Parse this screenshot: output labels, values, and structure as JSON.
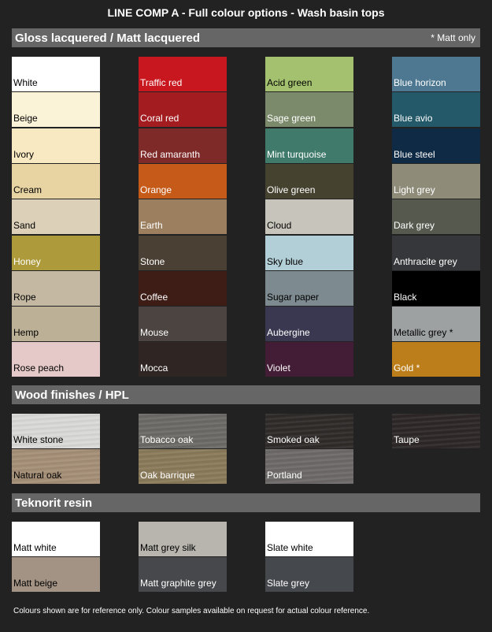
{
  "title": "LINE COMP A - Full colour options - Wash basin tops",
  "sections": [
    {
      "title": "Gloss lacquered / Matt lacquered",
      "note": "* Matt only",
      "columns": [
        [
          {
            "label": "White",
            "color": "#ffffff",
            "text": "#000000"
          },
          {
            "label": "Beige",
            "color": "#fbf3d7",
            "text": "#000000"
          },
          {
            "label": "Ivory",
            "color": "#f8e9c2",
            "text": "#000000"
          },
          {
            "label": "Cream",
            "color": "#e8d3a2",
            "text": "#000000"
          },
          {
            "label": "Sand",
            "color": "#dcd0b8",
            "text": "#000000"
          },
          {
            "label": "Honey",
            "color": "#ad9a3a",
            "text": "#ffffff"
          },
          {
            "label": "Rope",
            "color": "#c4b8a3",
            "text": "#000000"
          },
          {
            "label": "Hemp",
            "color": "#bcb096",
            "text": "#000000"
          },
          {
            "label": "Rose peach",
            "color": "#e5c8c8",
            "text": "#000000"
          }
        ],
        [
          {
            "label": "Traffic red",
            "color": "#c8171f",
            "text": "#ffffff"
          },
          {
            "label": "Coral red",
            "color": "#a21c20",
            "text": "#ffffff"
          },
          {
            "label": "Red amaranth",
            "color": "#7e2a28",
            "text": "#ffffff"
          },
          {
            "label": "Orange",
            "color": "#c55a19",
            "text": "#ffffff"
          },
          {
            "label": "Earth",
            "color": "#9b7f5e",
            "text": "#ffffff"
          },
          {
            "label": "Stone",
            "color": "#4a4034",
            "text": "#ffffff"
          },
          {
            "label": "Coffee",
            "color": "#3e1d17",
            "text": "#ffffff"
          },
          {
            "label": "Mouse",
            "color": "#4b4441",
            "text": "#ffffff"
          },
          {
            "label": "Mocca",
            "color": "#2f2624",
            "text": "#ffffff"
          }
        ],
        [
          {
            "label": "Acid green",
            "color": "#a4c16f",
            "text": "#000000"
          },
          {
            "label": "Sage green",
            "color": "#7b8a6a",
            "text": "#ffffff"
          },
          {
            "label": "Mint turquoise",
            "color": "#3f7a6b",
            "text": "#ffffff"
          },
          {
            "label": "Olive green",
            "color": "#45422f",
            "text": "#ffffff"
          },
          {
            "label": "Cloud",
            "color": "#c7c5bb",
            "text": "#000000"
          },
          {
            "label": "Sky blue",
            "color": "#b2ced6",
            "text": "#000000"
          },
          {
            "label": "Sugar paper",
            "color": "#7d8a90",
            "text": "#000000"
          },
          {
            "label": "Aubergine",
            "color": "#3a3750",
            "text": "#ffffff"
          },
          {
            "label": "Violet",
            "color": "#431c35",
            "text": "#ffffff"
          }
        ],
        [
          {
            "label": "Blue horizon",
            "color": "#4e7891",
            "text": "#ffffff"
          },
          {
            "label": "Blue avio",
            "color": "#24596a",
            "text": "#ffffff"
          },
          {
            "label": "Blue steel",
            "color": "#0e2a44",
            "text": "#ffffff"
          },
          {
            "label": "Light grey",
            "color": "#8e8b78",
            "text": "#ffffff"
          },
          {
            "label": "Dark grey",
            "color": "#565a4e",
            "text": "#ffffff"
          },
          {
            "label": "Anthracite grey",
            "color": "#35373a",
            "text": "#ffffff"
          },
          {
            "label": "Black",
            "color": "#000000",
            "text": "#ffffff"
          },
          {
            "label": "Metallic grey *",
            "color": "#9ea1a2",
            "text": "#000000"
          },
          {
            "label": "Gold *",
            "color": "#bb7e1b",
            "text": "#ffffff"
          }
        ]
      ]
    },
    {
      "title": "Wood finishes / HPL",
      "note": "",
      "columns": [
        [
          {
            "label": "White stone",
            "color": "#d9d9d7",
            "text": "#000000"
          },
          {
            "label": "Natural oak",
            "color": "#a58f77",
            "text": "#000000"
          }
        ],
        [
          {
            "label": "Tobacco oak",
            "color": "#6c6a66",
            "text": "#ffffff"
          },
          {
            "label": "Oak barrique",
            "color": "#8a7a5a",
            "text": "#ffffff"
          }
        ],
        [
          {
            "label": "Smoked oak",
            "color": "#2f2b29",
            "text": "#ffffff"
          },
          {
            "label": "Portland",
            "color": "#6d6969",
            "text": "#ffffff"
          }
        ],
        [
          {
            "label": "Taupe",
            "color": "#2d2827",
            "text": "#ffffff"
          }
        ]
      ]
    },
    {
      "title": "Teknorit resin",
      "note": "",
      "columns": [
        [
          {
            "label": "Matt white",
            "color": "#ffffff",
            "text": "#000000"
          },
          {
            "label": "Matt beige",
            "color": "#a39384",
            "text": "#000000"
          }
        ],
        [
          {
            "label": "Matt grey silk",
            "color": "#b8b5ae",
            "text": "#000000"
          },
          {
            "label": "Matt graphite grey",
            "color": "#47484b",
            "text": "#ffffff"
          }
        ],
        [
          {
            "label": "Slate white",
            "color": "#ffffff",
            "text": "#000000"
          },
          {
            "label": "Slate grey",
            "color": "#45484d",
            "text": "#ffffff"
          }
        ]
      ]
    }
  ],
  "footer": "Colours shown are for reference only. Colour samples available on request for actual colour reference."
}
